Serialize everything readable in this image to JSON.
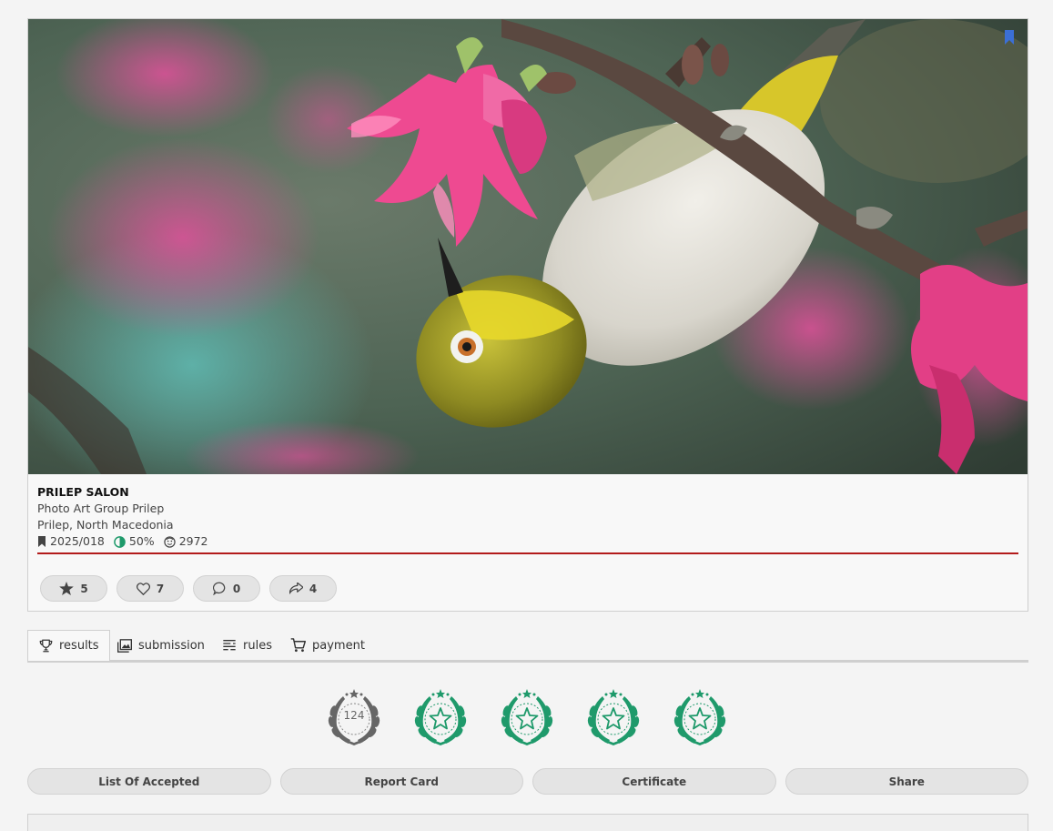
{
  "photo": {
    "description_icon": "bookmark-icon",
    "accent_bookmark": "#3b6fd6"
  },
  "salon": {
    "title": "PRILEP SALON",
    "organizer": "Photo Art Group Prilep",
    "location": "Prilep, North Macedonia",
    "code": "2025/018",
    "acceptance": "50%",
    "participants": "2972"
  },
  "actions": {
    "stars": "5",
    "likes": "7",
    "comments": "0",
    "shares": "4"
  },
  "tabs": [
    {
      "label": "results",
      "icon": "trophy-icon"
    },
    {
      "label": "submission",
      "icon": "images-icon"
    },
    {
      "label": "rules",
      "icon": "rules-icon"
    },
    {
      "label": "payment",
      "icon": "cart-icon"
    }
  ],
  "awards": {
    "count": "124",
    "colors": {
      "gray": "#666666",
      "green": "#1f9a6b"
    }
  },
  "buttons": {
    "accepted": "List Of Accepted",
    "report": "Report Card",
    "certificate": "Certificate",
    "share": "Share"
  },
  "colors": {
    "rule": "#b31b1b",
    "accent_green": "#1f9a6b"
  }
}
